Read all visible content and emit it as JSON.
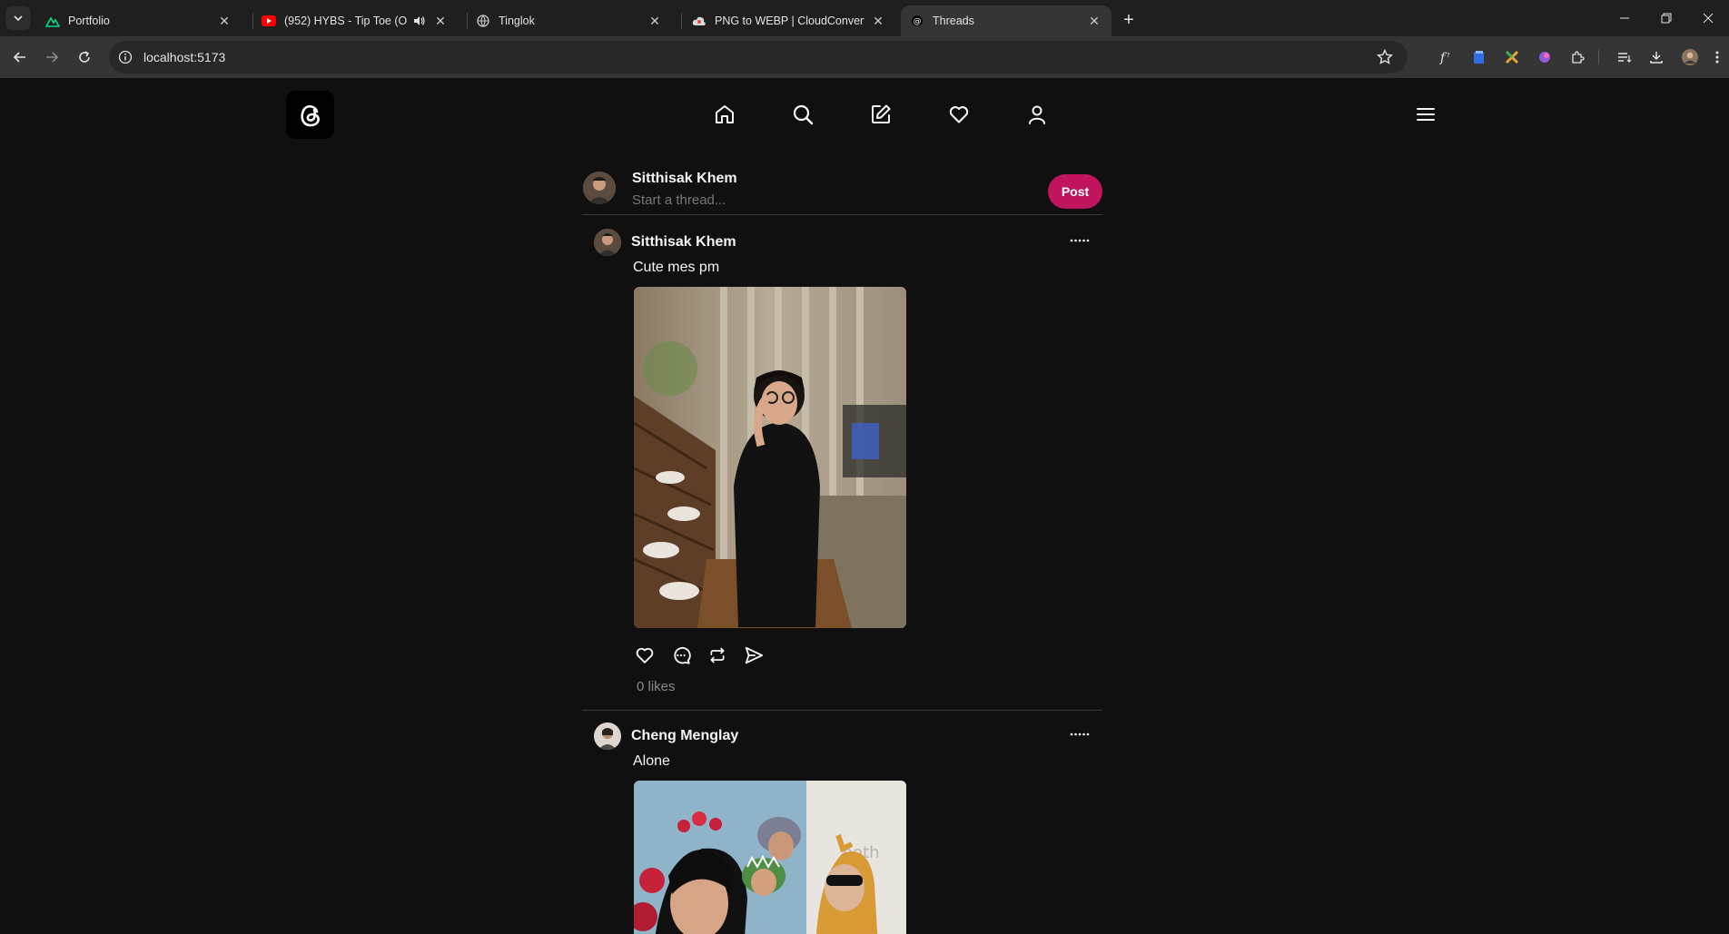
{
  "browser": {
    "tabs": [
      {
        "title": "Portfolio",
        "icon": "nuxt-icon"
      },
      {
        "title": "(952) HYBS - Tip Toe (Official",
        "icon": "youtube-icon"
      },
      {
        "title": "Tinglok",
        "icon": "globe-icon"
      },
      {
        "title": "PNG to WEBP | CloudConvert",
        "icon": "cloudconvert-icon"
      },
      {
        "title": "Threads",
        "icon": "threads-icon"
      }
    ],
    "active_tab": "Threads",
    "url": "localhost:5173"
  },
  "app": {
    "nav": [
      "home-icon",
      "search-icon",
      "compose-icon",
      "heart-icon",
      "profile-icon"
    ],
    "composer": {
      "user": "Sitthisak Khem",
      "placeholder": "Start a thread...",
      "post_label": "Post"
    },
    "posts": [
      {
        "author": "Sitthisak Khem",
        "text": "Cute mes pm",
        "likes": "0 likes"
      },
      {
        "author": "Cheng Menglay",
        "text": "Alone"
      }
    ]
  },
  "colors": {
    "accent": "#c0145e",
    "background": "#101010",
    "chrome_tabbar": "#1f1f1f",
    "chrome_toolbar": "#353535"
  }
}
